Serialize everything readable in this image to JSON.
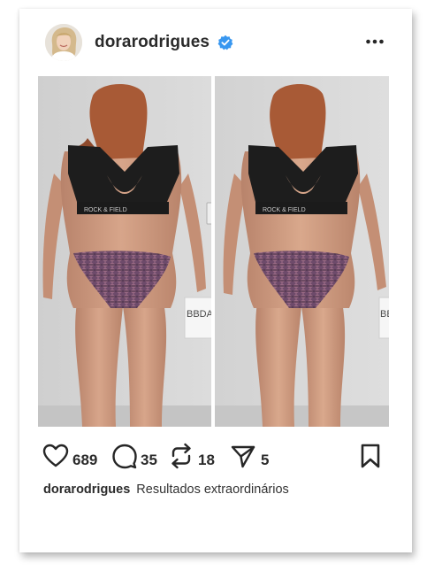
{
  "post": {
    "username": "dorarodrigues",
    "verified_icon": "verified-badge-icon",
    "more_icon": "more-options-icon",
    "photo": {
      "left_sign_text": "BBDAH",
      "right_sign_text": "BB",
      "left_waistband_text": "ROCK & FIELD",
      "right_waistband_text": "ROCK & FIELD"
    },
    "actions": {
      "likes": "689",
      "comments": "35",
      "reposts": "18",
      "shares": "5"
    },
    "caption": {
      "username": "dorarodrigues",
      "text": "Resultados extraordinários"
    }
  },
  "colors": {
    "verified": "#3897f0",
    "icon": "#262626",
    "text": "#2b2b2b",
    "wall": "#d6d6d6"
  }
}
